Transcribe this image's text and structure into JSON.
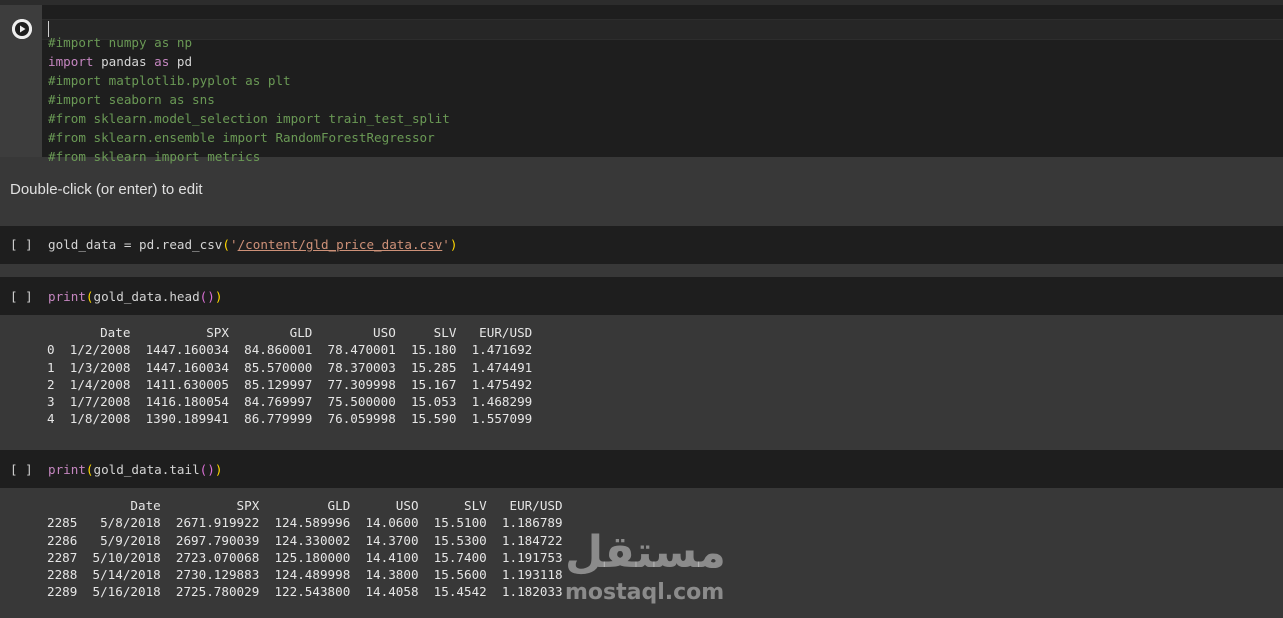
{
  "cell1": {
    "lines": [
      "#import numpy as np",
      "import pandas as pd",
      "#import matplotlib.pyplot as plt",
      "#import seaborn as sns",
      "#from sklearn.model_selection import train_test_split",
      "#from sklearn.ensemble import RandomForestRegressor",
      "#from sklearn import metrics"
    ],
    "line2_kw1": "import",
    "line2_mid": " pandas ",
    "line2_kw2": "as",
    "line2_end": " pd"
  },
  "text_cell": "Double-click (or enter) to edit",
  "bracket": "[ ]",
  "cell2": {
    "code_a": "gold_data = pd.read_csv",
    "open": "(",
    "q1": "'",
    "path": "/content/gld_price_data.csv",
    "q2": "'",
    "close": ")"
  },
  "cell3": {
    "code_a": "print",
    "open": "(",
    "code_b": "gold_data.head",
    "inner": "()",
    "close": ")",
    "output": "       Date          SPX        GLD        USO     SLV   EUR/USD\n0  1/2/2008  1447.160034  84.860001  78.470001  15.180  1.471692\n1  1/3/2008  1447.160034  85.570000  78.370003  15.285  1.474491\n2  1/4/2008  1411.630005  85.129997  77.309998  15.167  1.475492\n3  1/7/2008  1416.180054  84.769997  75.500000  15.053  1.468299\n4  1/8/2008  1390.189941  86.779999  76.059998  15.590  1.557099"
  },
  "cell4": {
    "code_a": "print",
    "open": "(",
    "code_b": "gold_data.tail",
    "inner": "()",
    "close": ")",
    "output": "           Date          SPX         GLD      USO      SLV   EUR/USD\n2285   5/8/2018  2671.919922  124.589996  14.0600  15.5100  1.186789\n2286   5/9/2018  2697.790039  124.330002  14.3700  15.5300  1.184722\n2287  5/10/2018  2723.070068  125.180000  14.4100  15.7400  1.191753\n2288  5/14/2018  2730.129883  124.489998  14.3800  15.5600  1.193118\n2289  5/16/2018  2725.780029  122.543800  14.4058  15.4542  1.182033"
  },
  "watermark": {
    "arabic": "مستقل",
    "latin": "mostaql.com"
  },
  "icons": {
    "run": "play-icon"
  },
  "colors": {
    "editor_bg": "#1e1e1e",
    "page_bg": "#383838",
    "comment": "#6a9955",
    "keyword": "#c586c0",
    "string": "#ce9178"
  }
}
